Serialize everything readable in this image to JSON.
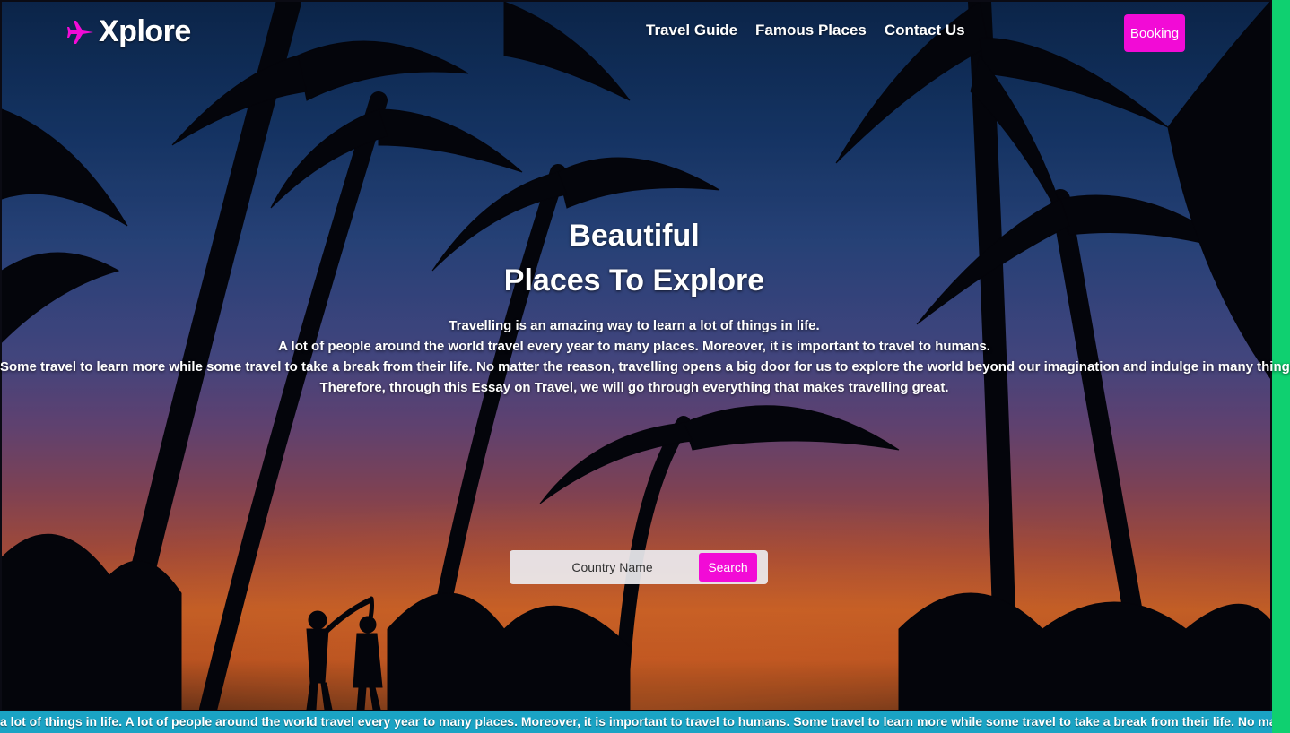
{
  "brand": {
    "name": "Xplore",
    "icon": "airplane-icon",
    "accent_color": "#f20bd6"
  },
  "nav": {
    "items": [
      {
        "label": "Travel Guide"
      },
      {
        "label": "Famous Places"
      },
      {
        "label": "Contact Us"
      }
    ],
    "booking_label": "Booking"
  },
  "hero": {
    "title_line1": "Beautiful",
    "title_line2": "Places To Explore",
    "paragraph_lines": [
      "Travelling is an amazing way to learn a lot of things in life.",
      "A lot of people around the world travel every year to many places. Moreover, it is important to travel to humans.",
      "Some travel to learn more while some travel to take a break from their life. No matter the reason, travelling opens a big door for us to explore the world beyond our imagination and indulge in many things.",
      "Therefore, through this Essay on Travel, we will go through everything that makes travelling great."
    ]
  },
  "search": {
    "placeholder": "Country Name",
    "button_label": "Search"
  },
  "marquee": {
    "text": "a lot of things in life. A lot of people around the world travel every year to many places. Moreover, it is important to travel to humans. Some travel to learn more while some travel to take a break from their life. No matte",
    "background_color": "#1aa3c4"
  }
}
